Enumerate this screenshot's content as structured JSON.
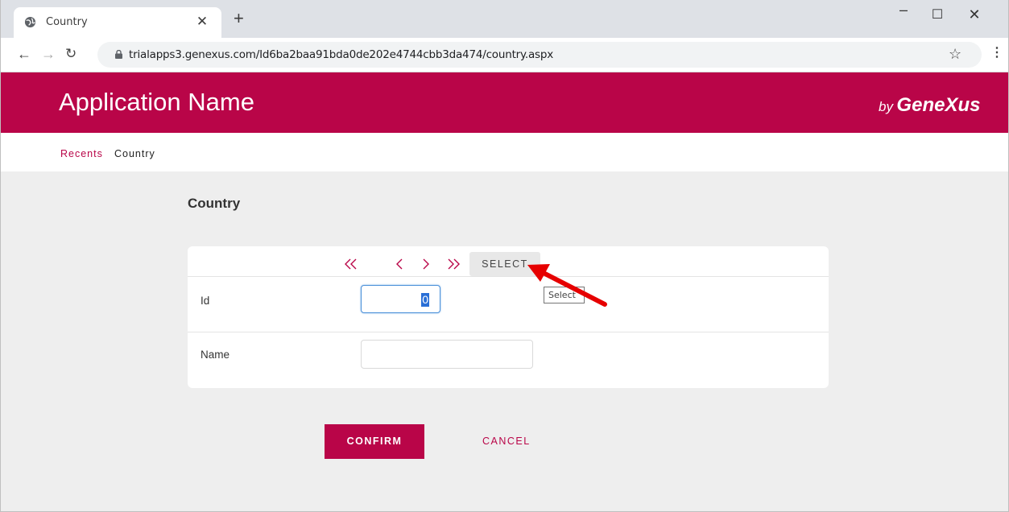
{
  "browser": {
    "tab_title": "Country",
    "url": "trialapps3.genexus.com/Id6ba2baa91bda0de202e4744cbb3da474/country.aspx"
  },
  "header": {
    "app_name": "Application Name",
    "brand_by": "by",
    "brand_name": "GeneXus"
  },
  "breadcrumb": {
    "recents": "Recents",
    "current": "Country"
  },
  "page": {
    "title": "Country"
  },
  "nav": {
    "first_glyph": "«",
    "prev_glyph": "‹",
    "next_glyph": "›",
    "last_glyph": "»",
    "select_label": "SELECT"
  },
  "form": {
    "id_label": "Id",
    "id_value": "0",
    "name_label": "Name",
    "name_value": ""
  },
  "tooltip": {
    "text": "Select"
  },
  "actions": {
    "confirm_label": "CONFIRM",
    "cancel_label": "CANCEL"
  },
  "colors": {
    "brand": "#b90548",
    "background": "#eeeeee",
    "annotation_arrow": "#e60000"
  },
  "icons": [
    "globe-icon",
    "close-icon",
    "plus-icon",
    "minimize-icon",
    "maximize-icon",
    "window-close-icon",
    "back-icon",
    "forward-icon",
    "reload-icon",
    "lock-icon",
    "star-icon",
    "menu-icon",
    "first-icon",
    "prev-icon",
    "next-icon",
    "last-icon"
  ]
}
